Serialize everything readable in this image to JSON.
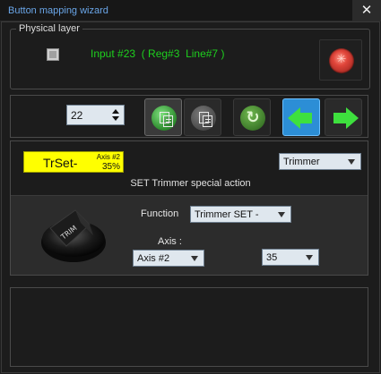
{
  "window": {
    "title": "Button mapping wizard",
    "close_label": "✕"
  },
  "physical_layer": {
    "legend": "Physical layer",
    "input_info": "Input #23  ( Reg#3  Line#7 )"
  },
  "toolbar": {
    "button_number": "22"
  },
  "mapping": {
    "trset_label": "TrSet-",
    "trset_axis": "Axis #2",
    "trset_value": "35%",
    "action_type": "Trimmer",
    "description": "SET Trimmer special action",
    "function_label": "Function",
    "function_value": "Trimmer SET -",
    "axis_label": "Axis :",
    "axis_value": "Axis #2",
    "amount_value": "35"
  },
  "knob": {
    "text": "TRIM"
  },
  "colors": {
    "title": "#6aa6e8",
    "input_info": "#1ed01e",
    "highlight": "#ffff00",
    "nav_active": "#2c8ed6",
    "arrow": "#3ee03e"
  },
  "icons": [
    "close-icon",
    "fire-icon",
    "paste-icon",
    "copy-icon",
    "refresh-icon",
    "left-arrow-icon",
    "right-arrow-icon",
    "trim-knob-icon"
  ]
}
